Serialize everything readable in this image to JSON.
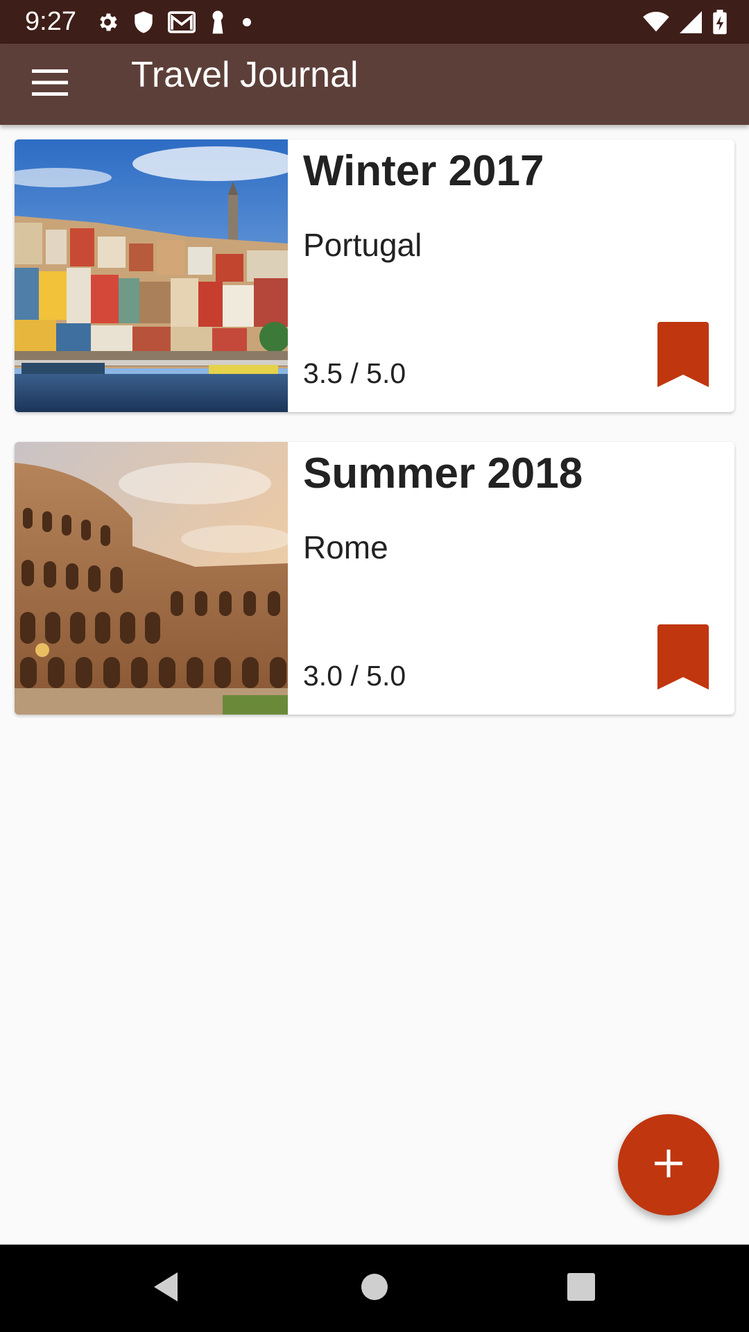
{
  "status_bar": {
    "time": "9:27",
    "left_icons": [
      "gear-icon",
      "shield-icon",
      "gmail-icon",
      "keyhole-icon",
      "dot-icon"
    ],
    "right_icons": [
      "wifi-icon",
      "signal-icon",
      "battery-charging-icon"
    ]
  },
  "app_bar": {
    "title": "Travel Journal",
    "menu_icon": "hamburger-menu-icon",
    "background_color": "#5d3f39"
  },
  "trips": [
    {
      "title": "Winter 2017",
      "location": "Portugal",
      "rating": "3.5 / 5.0",
      "image": "porto-riverside-photo",
      "bookmark_icon": "bookmark-icon"
    },
    {
      "title": "Summer 2018",
      "location": "Rome",
      "rating": "3.0 / 5.0",
      "image": "colosseum-photo",
      "bookmark_icon": "bookmark-icon"
    }
  ],
  "fab": {
    "icon": "plus-icon",
    "color": "#c0360f"
  },
  "accent_color": "#c0360f",
  "nav_bar": {
    "buttons": [
      "back-triangle-icon",
      "home-circle-icon",
      "recents-square-icon"
    ]
  }
}
